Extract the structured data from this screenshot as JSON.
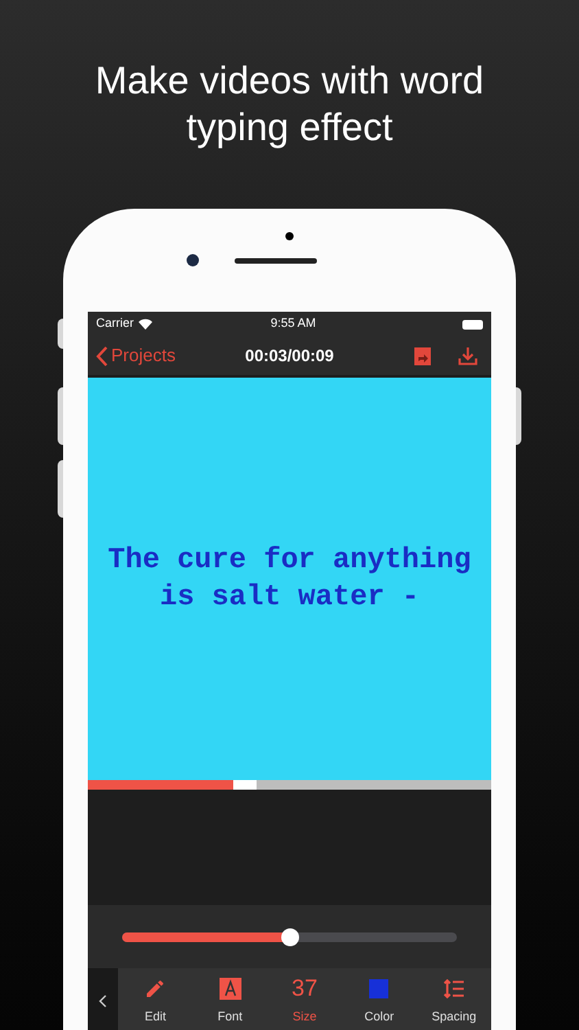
{
  "headline": "Make videos with word typing effect",
  "status_bar": {
    "carrier": "Carrier",
    "time": "9:55 AM"
  },
  "nav_bar": {
    "back": "Projects",
    "title": "00:03/00:09"
  },
  "video": {
    "text": "The cure for anything is salt water -"
  },
  "playback": {
    "level": 0.36
  },
  "size_slider": {
    "level": 0.5
  },
  "toolbar": [
    {
      "kind": "pencil",
      "label": "Edit",
      "selected": false
    },
    {
      "kind": "font",
      "label": "Font",
      "selected": false
    },
    {
      "kind": "value",
      "value": "37",
      "label": "Size",
      "selected": true
    },
    {
      "kind": "swatch",
      "color": "#1730d8",
      "label": "Color",
      "selected": false
    },
    {
      "kind": "spacing",
      "label": "Spacing",
      "selected": false
    }
  ]
}
